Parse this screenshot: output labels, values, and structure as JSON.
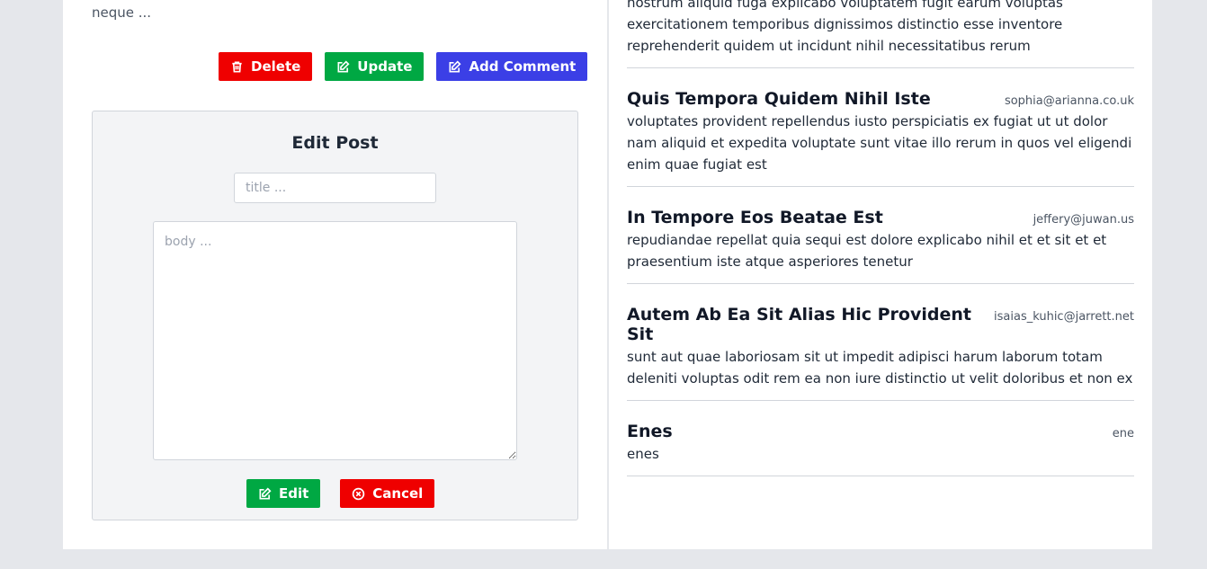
{
  "post": {
    "body_tail": "neque ...",
    "actions": {
      "delete_label": "Delete",
      "update_label": "Update",
      "add_comment_label": "Add Comment"
    }
  },
  "edit_post": {
    "heading": "Edit Post",
    "title_placeholder": "title ...",
    "body_placeholder": "body ...",
    "edit_label": "Edit",
    "cancel_label": "Cancel"
  },
  "comments": {
    "first_tail": "nostrum aliquid fuga explicabo voluptatem fugit earum voluptas exercitationem temporibus dignissimos distinctio esse inventore reprehenderit quidem ut incidunt nihil necessitatibus rerum",
    "items": [
      {
        "title": "Quis Tempora Quidem Nihil Iste",
        "email": "sophia@arianna.co.uk",
        "body": "voluptates provident repellendus iusto perspiciatis ex fugiat ut ut dolor nam aliquid et expedita voluptate sunt vitae illo rerum in quos vel eligendi enim quae fugiat est"
      },
      {
        "title": "In Tempore Eos Beatae Est",
        "email": "jeffery@juwan.us",
        "body": "repudiandae repellat quia sequi est dolore explicabo nihil et et sit et et praesentium iste atque asperiores tenetur"
      },
      {
        "title": "Autem Ab Ea Sit Alias Hic Provident Sit",
        "email": "isaias_kuhic@jarrett.net",
        "body": "sunt aut quae laboriosam sit ut impedit adipisci harum laborum totam deleniti voluptas odit rem ea non iure distinctio ut velit doloribus et non ex"
      },
      {
        "title": "Enes",
        "email": "ene",
        "body": "enes"
      }
    ]
  },
  "colors": {
    "danger": "#ef0000",
    "success": "#00a843",
    "primary": "#3b3fe6"
  },
  "icons": {
    "delete": "trash-icon",
    "update": "pencil-square-icon",
    "add_comment": "pencil-square-icon",
    "edit": "pencil-square-icon",
    "cancel": "x-circle-icon"
  }
}
